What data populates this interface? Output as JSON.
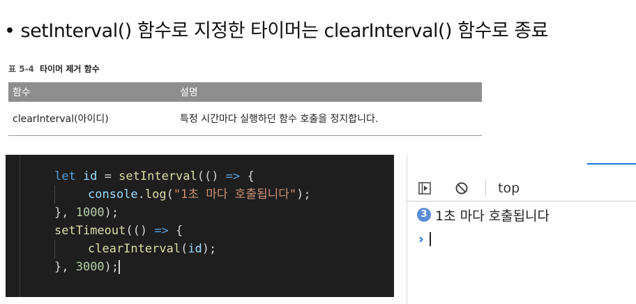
{
  "headline": {
    "bullet": "•",
    "text": "setInterval() 함수로 지정한 타이머는 clearInterval() 함수로 종료"
  },
  "table": {
    "caption_num": "표 5-4",
    "caption_title": "타이머 제거 함수",
    "headers": [
      "함수",
      "설명"
    ],
    "rows": [
      [
        "clearInterval(아이디)",
        "특정 시간마다 실행하던 함수 호출을 정지합니다."
      ]
    ]
  },
  "code": {
    "lines": [
      {
        "indent": 0,
        "tokens": [
          {
            "t": "let",
            "c": "kw"
          },
          {
            "t": " ",
            "c": "punc"
          },
          {
            "t": "id",
            "c": "var"
          },
          {
            "t": " = ",
            "c": "punc"
          },
          {
            "t": "setInterval",
            "c": "fn"
          },
          {
            "t": "(() ",
            "c": "punc"
          },
          {
            "t": "=>",
            "c": "arrow"
          },
          {
            "t": " {",
            "c": "punc"
          }
        ]
      },
      {
        "indent": 1,
        "tokens": [
          {
            "t": "console",
            "c": "var"
          },
          {
            "t": ".",
            "c": "punc"
          },
          {
            "t": "log",
            "c": "fn"
          },
          {
            "t": "(",
            "c": "punc"
          },
          {
            "t": "\"1초 마다 호출됩니다\"",
            "c": "str"
          },
          {
            "t": ");",
            "c": "punc"
          }
        ]
      },
      {
        "indent": 0,
        "tokens": [
          {
            "t": "}, ",
            "c": "punc"
          },
          {
            "t": "1000",
            "c": "num"
          },
          {
            "t": ");",
            "c": "punc"
          }
        ]
      },
      {
        "indent": 0,
        "tokens": [
          {
            "t": "setTimeout",
            "c": "fn"
          },
          {
            "t": "(() ",
            "c": "punc"
          },
          {
            "t": "=>",
            "c": "arrow"
          },
          {
            "t": " {",
            "c": "punc"
          }
        ]
      },
      {
        "indent": 1,
        "tokens": [
          {
            "t": "clearInterval",
            "c": "fn"
          },
          {
            "t": "(",
            "c": "punc"
          },
          {
            "t": "id",
            "c": "var"
          },
          {
            "t": ");",
            "c": "punc"
          }
        ]
      },
      {
        "indent": 0,
        "cursor": true,
        "tokens": [
          {
            "t": "}, ",
            "c": "punc"
          },
          {
            "t": "3000",
            "c": "num"
          },
          {
            "t": ");",
            "c": "punc"
          }
        ]
      }
    ]
  },
  "console": {
    "toolbar": {
      "panel_icon": "sidebar-toggle-icon",
      "clear_icon": "block-icon",
      "context": "top"
    },
    "message": {
      "count": "3",
      "text": "1초 마다 호출됩니다"
    },
    "prompt_glyph": "›",
    "colors": {
      "accent": "#1a73e8",
      "badge": "#5a8dd6"
    }
  }
}
